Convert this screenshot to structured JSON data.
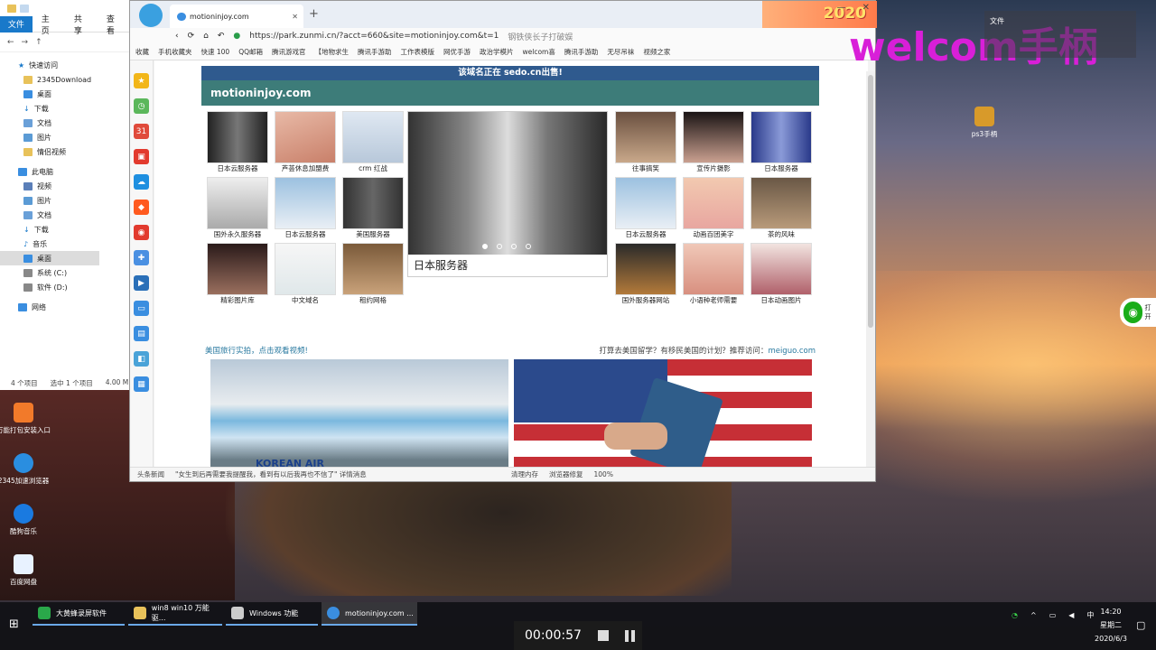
{
  "explorer": {
    "ribbon": [
      "文件",
      "主页",
      "共享",
      "查看"
    ],
    "quick_access": "快速访问",
    "items": [
      "2345Download",
      "桌面",
      "下载",
      "文档",
      "图片",
      "情侣视频"
    ],
    "this_pc": "此电脑",
    "pc_items": [
      "视频",
      "图片",
      "文档",
      "下载",
      "音乐",
      "桌面",
      "系统 (C:)",
      "软件 (D:)"
    ],
    "network": "网络",
    "status_count": "4 个项目",
    "status_sel": "选中 1 个项目",
    "status_size": "4.00 M"
  },
  "browser": {
    "tab_title": "motioninjoy.com",
    "year_badge": "2020",
    "url": "https://park.zunmi.cn/?acct=660&site=motioninjoy.com&t=1",
    "search_hint": "钢铁侠长子打破娱",
    "bookmarks": [
      "收藏",
      "手机收藏夹",
      "快速 100",
      "QQ邮箱",
      "腾讯游戏官",
      "【地物求生",
      "腾讯手游助",
      "工作表模版",
      "网优手游",
      "政治学模片",
      "welcom喜",
      "腾讯手游助",
      "无尽吊袜",
      "视频之家"
    ],
    "status_items": [
      "头条新闻",
      "\"女生到后再需要我提醒我，看到有以后我再也不信了\" 详情消息",
      "清理内存",
      "浏览器修复",
      "100%"
    ]
  },
  "page": {
    "sedo_text": "该域名正在 sedo.cn出售!",
    "site_title": "motioninjoy.com",
    "left_grid": [
      "日本云服务器",
      "芦荟休息加盟费",
      "crm 红战",
      "国外永久服务器",
      "日本云服务器",
      "美国服务器",
      "精彩图片库",
      "中文域名",
      "租约网格"
    ],
    "carousel_caption": "日本服务器",
    "right_grid": [
      "往事搞笑",
      "宣传片摄影",
      "日本服务器",
      "日本云服务器",
      "动画百团美字",
      "茶的风味",
      "国外服务器网站",
      "小语种老师需要",
      "日本动画图片"
    ],
    "promo_left": "美国旅行实拍，点击观看视频!",
    "promo_right_text": "打算去美国留学？有移民美国的计划？推荐访问：",
    "promo_right_link": "meiguo.com",
    "plane_logo": "KOREAN AIR"
  },
  "overlay": {
    "title": "welcom手柄",
    "panel_label": "文件"
  },
  "desktop_icons": [
    "万能打包安装入口",
    "2345加速浏览器",
    "酷狗音乐",
    "百度网盘"
  ],
  "pc_icon_label": "ps3手柄",
  "wifi_text": "打开",
  "taskbar": {
    "apps": [
      "大黄蜂录屏软件",
      "win8 win10 万能驱...",
      "Windows 功能",
      "motioninjoy.com ..."
    ],
    "recorder_time": "00:00:57",
    "ime": "中",
    "time": "14:20",
    "weekday": "星期二",
    "date": "2020/6/3"
  }
}
